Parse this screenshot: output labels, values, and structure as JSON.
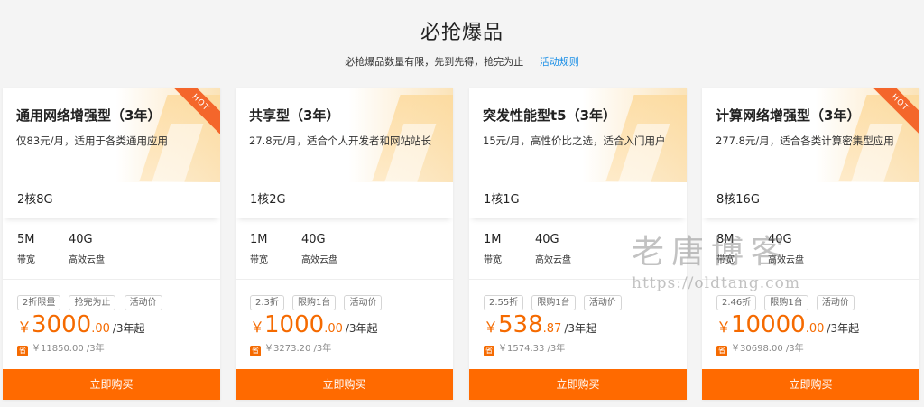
{
  "header": {
    "title": "必抢爆品",
    "subtitle": "必抢爆品数量有限，先到先得，抢完为止",
    "rules_link": "活动规则"
  },
  "cards": [
    {
      "title": "通用网络增强型（3年）",
      "hot": "HOT",
      "desc": "仅83元/月，适用于各类通用应用",
      "cpu_mem": "2核8G",
      "bandwidth_value": "5M",
      "bandwidth_label": "带宽",
      "disk_value": "40G",
      "disk_label": "高效云盘",
      "tags": [
        "2折限量",
        "抢完为止",
        "活动价"
      ],
      "currency": "￥",
      "price_int": "3000",
      "price_dec": ".00",
      "price_unit": "/3年起",
      "save_icon": "省",
      "original_price": "￥11850.00 /3年",
      "buy_label": "立即购买"
    },
    {
      "title": "共享型（3年）",
      "hot": "",
      "desc": "27.8元/月，适合个人开发者和网站站长",
      "cpu_mem": "1核2G",
      "bandwidth_value": "1M",
      "bandwidth_label": "带宽",
      "disk_value": "40G",
      "disk_label": "高效云盘",
      "tags": [
        "2.3折",
        "限购1台",
        "活动价"
      ],
      "currency": "￥",
      "price_int": "1000",
      "price_dec": ".00",
      "price_unit": "/3年起",
      "save_icon": "省",
      "original_price": "￥3273.20 /3年",
      "buy_label": "立即购买"
    },
    {
      "title": "突发性能型t5（3年）",
      "hot": "",
      "desc": "15元/月，高性价比之选，适合入门用户",
      "cpu_mem": "1核1G",
      "bandwidth_value": "1M",
      "bandwidth_label": "带宽",
      "disk_value": "40G",
      "disk_label": "高效云盘",
      "tags": [
        "2.55折",
        "限购1台",
        "活动价"
      ],
      "currency": "￥",
      "price_int": "538",
      "price_dec": ".87",
      "price_unit": "/3年起",
      "save_icon": "省",
      "original_price": "￥1574.33 /3年",
      "buy_label": "立即购买"
    },
    {
      "title": "计算网络增强型（3年）",
      "hot": "HOT",
      "desc": "277.8元/月，适合各类计算密集型应用",
      "cpu_mem": "8核16G",
      "bandwidth_value": "8M",
      "bandwidth_label": "带宽",
      "disk_value": "40G",
      "disk_label": "高效云盘",
      "tags": [
        "2.46折",
        "限购1台",
        "活动价"
      ],
      "currency": "￥",
      "price_int": "10000",
      "price_dec": ".00",
      "price_unit": "/3年起",
      "save_icon": "省",
      "original_price": "￥30698.00 /3年",
      "buy_label": "立即购买"
    }
  ],
  "watermark": {
    "name": "老唐博客",
    "url": "https://oldtang.com"
  },
  "colors": {
    "accent": "#ff6a00",
    "link": "#1b8fe6",
    "hot": "#f4662b"
  }
}
